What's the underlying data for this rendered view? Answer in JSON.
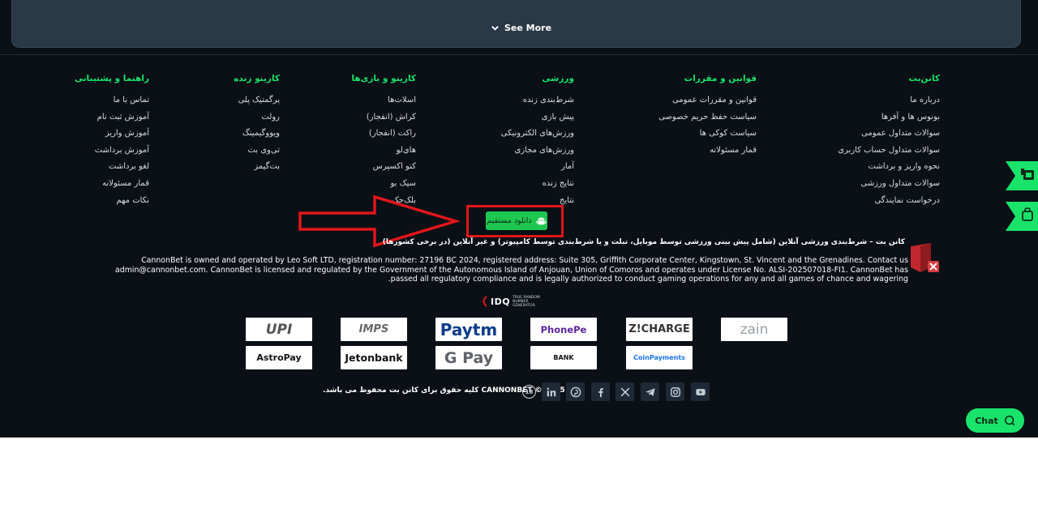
{
  "see_more_label": "See More",
  "columns": [
    {
      "title": "کانن‌بت",
      "items": [
        "درباره ما",
        "بونوس ها و آفرها",
        "سوالات متداول عمومی",
        "سوالات متداول حساب کاربری",
        "نحوه واریز و برداشت",
        "سوالات متداول ورزشی",
        "درخواست نمایندگی"
      ]
    },
    {
      "title": "قوانین و مقررات",
      "items": [
        "قوانین و مقررات عمومی",
        "سیاست حفظ حریم خصوصی",
        "سیاست کوکی ها",
        "قمار مسئولانه"
      ]
    },
    {
      "title": "ورزشی",
      "items": [
        "شرط‌بندی زنده",
        "پیش بازی",
        "ورزش‌های الکترونیکی",
        "ورزش‌های مجازی",
        "آمار",
        "نتایج زنده",
        "نتایج"
      ]
    },
    {
      "title": "کازینو و بازی‌ها",
      "items": [
        "اسلات‌ها",
        "کراش (انفجار)",
        "راکت (انفجار)",
        "های‌لو",
        "کنو اکسپرس",
        "سیک بو",
        "بلک‌جک"
      ]
    },
    {
      "title": "کازینو زنده",
      "items": [
        "پرگمتیک پلی",
        "رولت",
        "ویووگیمینگ",
        "تی‌وی بت",
        "بت‌گیمز"
      ]
    },
    {
      "title": "راهنما و پشتیبانی",
      "items": [
        "تماس با ما",
        "آموزش ثبت نام",
        "آموزش واریز",
        "آموزش برداشت",
        "لغو برداشت",
        "قمار مسئولانه",
        "نکات مهم"
      ]
    }
  ],
  "download_label": "دانلود مستقیم",
  "tagline": "کانن بت – شرط‌بندی ورزشی آنلاین (شامل پیش بینی ورزشی توسط موبایل، تبلت و یا شرط‌بندی توسط کامپیوتر) و غیر آنلاین (در برخی کشورها)",
  "license_text": "CannonBet is owned and operated by Leo Soft LTD, registration number: 27196 BC 2024, registered address: Suite 305, Griffith Corporate Center, Kingstown, St. Vincent and the Grenadines. Contact us admin@cannonbet.com. CannonBet is licensed and regulated by the Government of the Autonomous Island of Anjouan, Union of Comoros and operates under License No. ALSI-202507018-FI1. CannonBet has passed all regulatory compliance and is legally authorized to conduct gaming operations for any and all games of chance and wagering.",
  "idq": {
    "mark": "IDQ",
    "sub": "TRUE RANDOM NUMBER GENERATOR"
  },
  "payments": [
    {
      "name": "UPI",
      "label": "UPI",
      "color": "#555555"
    },
    {
      "name": "IMPS",
      "label": "IMPS",
      "color": "#666666"
    },
    {
      "name": "Paytm",
      "label": "Paytm",
      "color": "#0f3c8a"
    },
    {
      "name": "PhonePe",
      "label": "PhonePe",
      "color": "#5f259f"
    },
    {
      "name": "Z!CHARGE",
      "label": "Z!CHARGE",
      "color": "#333333"
    },
    {
      "name": "zain",
      "label": "zain",
      "color": "#9aa0a6"
    },
    {
      "name": "AstroPay",
      "label": "AstroPay",
      "color": "#111111"
    },
    {
      "name": "Jetonbank",
      "label": "Jetonbank",
      "color": "#111111"
    },
    {
      "name": "G Pay",
      "label": "G Pay",
      "color": "#5f6368"
    },
    {
      "name": "Bank",
      "label": "BANK",
      "color": "#111111"
    },
    {
      "name": "CoinPayments",
      "label": "CoinPayments",
      "color": "#1a73e8"
    }
  ],
  "age_badge": "18",
  "copyright": "CANNONBET © 2025 کلیه حقوق برای کانن بت محفوظ می باشد.",
  "chat_label": "Chat",
  "colors": {
    "accent": "#19e36b",
    "footer_bg": "#0b0f16",
    "annotation_red": "#e0161b"
  }
}
